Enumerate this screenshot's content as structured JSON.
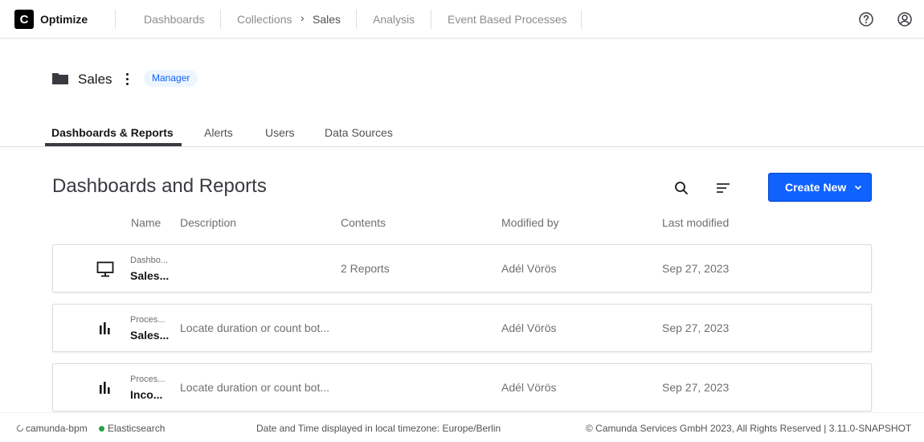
{
  "app": {
    "logo_letter": "C",
    "name": "Optimize"
  },
  "nav": {
    "dashboards": "Dashboards",
    "collections": "Collections",
    "breadcrumb_sep": "›",
    "current_collection": "Sales",
    "analysis": "Analysis",
    "event_processes": "Event Based Processes"
  },
  "icons": {
    "help": "help-circle-icon",
    "user": "user-avatar-icon",
    "folder": "folder-icon",
    "search": "search-icon",
    "sort": "sort-icon",
    "dashboard": "monitor-icon",
    "report": "bar-chart-icon"
  },
  "collection": {
    "title": "Sales",
    "role": "Manager"
  },
  "tabs": [
    {
      "label": "Dashboards & Reports",
      "active": true
    },
    {
      "label": "Alerts",
      "active": false
    },
    {
      "label": "Users",
      "active": false
    },
    {
      "label": "Data Sources",
      "active": false
    }
  ],
  "section": {
    "title": "Dashboards and Reports",
    "create_label": "Create New"
  },
  "columns": [
    "Name",
    "Description",
    "Contents",
    "Modified by",
    "Last modified"
  ],
  "rows": [
    {
      "kind": "dashboard",
      "type": "Dashbo...",
      "name": "Sales...",
      "description": "",
      "contents": "2 Reports",
      "modified_by": "Adél Vörös",
      "last_modified": "Sep 27, 2023"
    },
    {
      "kind": "report",
      "type": "Proces...",
      "name": "Sales...",
      "description": "Locate duration or count bot...",
      "contents": "",
      "modified_by": "Adél Vörös",
      "last_modified": "Sep 27, 2023"
    },
    {
      "kind": "report",
      "type": "Proces...",
      "name": "Inco...",
      "description": "Locate duration or count bot...",
      "contents": "",
      "modified_by": "Adél Vörös",
      "last_modified": "Sep 27, 2023"
    }
  ],
  "footer": {
    "engine": "camunda-bpm",
    "db": "Elasticsearch",
    "timezone": "Date and Time displayed in local timezone: Europe/Berlin",
    "copyright": "© Camunda Services GmbH 2023, All Rights Reserved | 3.11.0-SNAPSHOT"
  },
  "colors": {
    "primary": "#0f62fe",
    "status_ok": "#24a148",
    "badge_bg": "#edf5ff"
  }
}
